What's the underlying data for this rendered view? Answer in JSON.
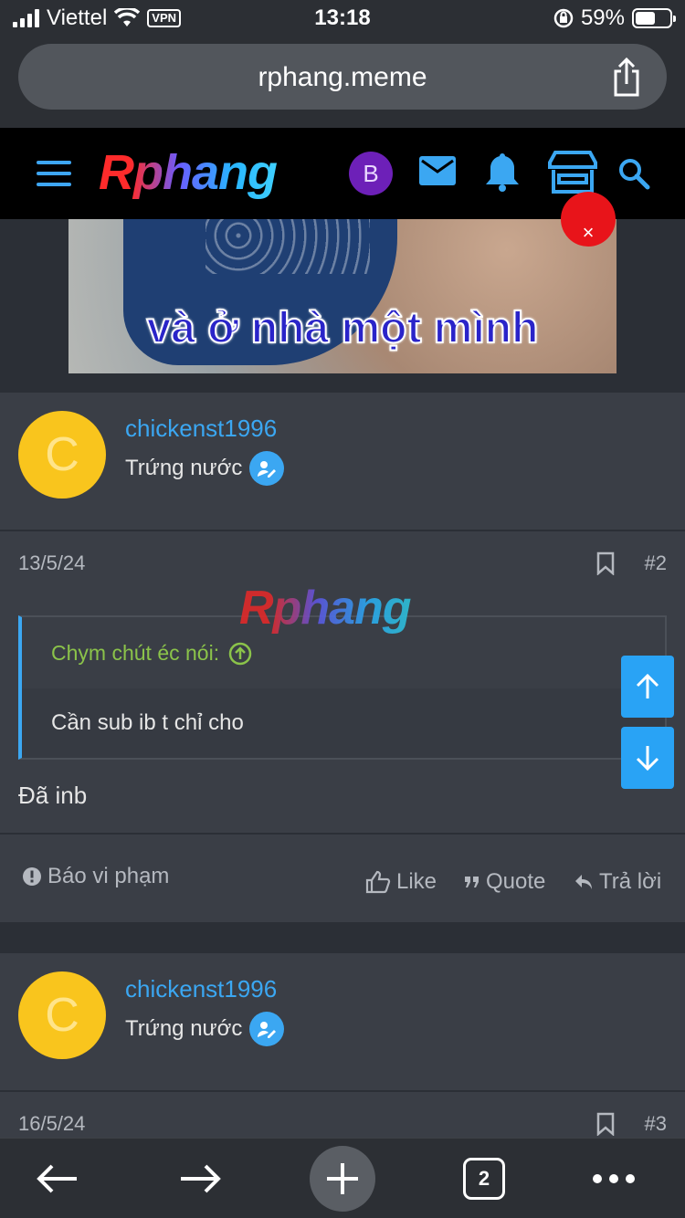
{
  "status": {
    "carrier": "Viettel",
    "vpn": "VPN",
    "time": "13:18",
    "battery": "59%",
    "battery_level": 0.59
  },
  "browser": {
    "url": "rphang.meme",
    "tabs_count": "2"
  },
  "site": {
    "logo": "Rphang",
    "user_initial": "B",
    "accent": "#3ba7f2"
  },
  "ad": {
    "caption": "và ở nhà một mình",
    "close": "×"
  },
  "posts": [
    {
      "author": "chickenst1996",
      "avatar_letter": "C",
      "role": "Trứng nước",
      "date": "13/5/24",
      "number": "#2",
      "watermark": "Rphang",
      "quote_author": "Chym chút éc nói:",
      "quote_text": "Cần sub ib t chỉ cho",
      "message": "Đã inb",
      "actions": {
        "report": "Báo vi phạm",
        "like": "Like",
        "quote": "Quote",
        "reply": "Trả lời"
      }
    },
    {
      "author": "chickenst1996",
      "avatar_letter": "C",
      "role": "Trứng nước",
      "date": "16/5/24",
      "number": "#3"
    }
  ]
}
